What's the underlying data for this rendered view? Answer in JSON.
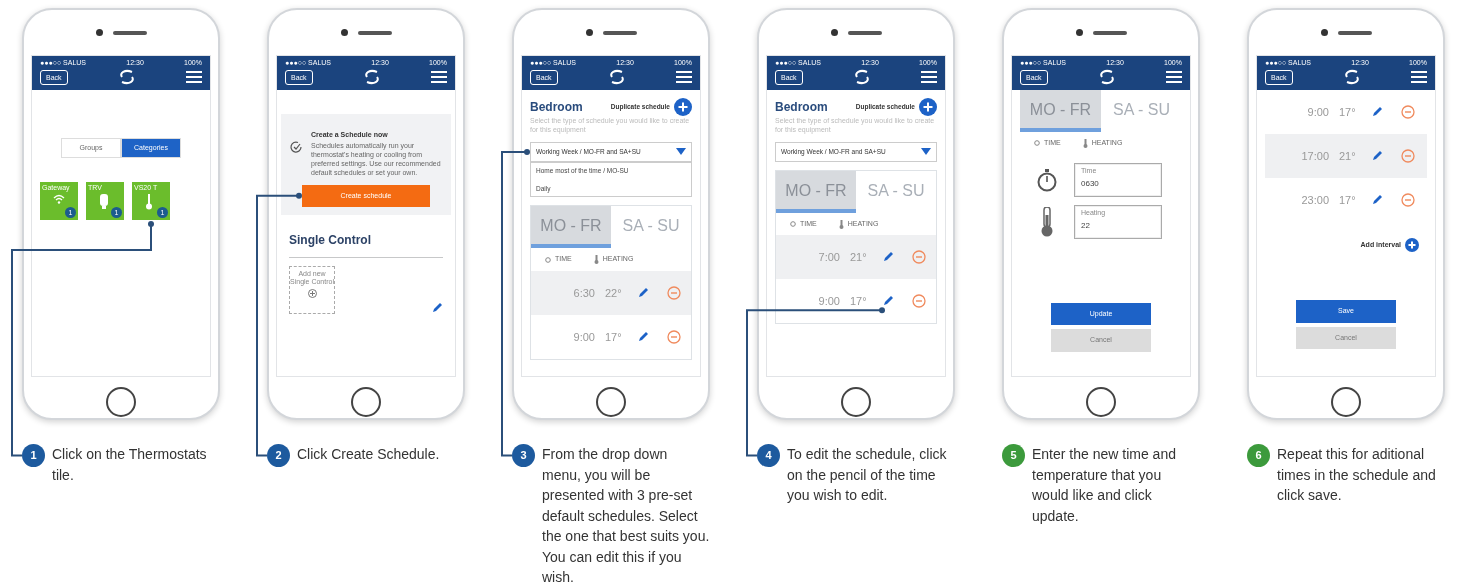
{
  "steps": [
    {
      "number": "1",
      "color": "#1d5a9e",
      "caption": "Click on the Thermostats tile.",
      "screen": {
        "kind": "devices",
        "status": {
          "carrier": "●●●○○ SALUS",
          "time": "12:30",
          "battery": "100%"
        },
        "back": "Back",
        "segments": [
          {
            "label": "Groups",
            "selected": false
          },
          {
            "label": "Categories",
            "selected": true
          }
        ],
        "tiles": [
          {
            "label": "Gateway",
            "count": "1",
            "kind": "gateway"
          },
          {
            "label": "TRV",
            "count": "1",
            "kind": "valve"
          },
          {
            "label": "VS20 T",
            "count": "1",
            "kind": "thermostat"
          }
        ]
      }
    },
    {
      "number": "2",
      "color": "#1d5a9e",
      "caption": "Click Create Schedule.",
      "screen": {
        "kind": "create",
        "status": {
          "carrier": "●●●○○ SALUS",
          "time": "12:30",
          "battery": "100%"
        },
        "back": "Back",
        "title": "Create a Schedule now",
        "text": "Schedules automatically run your thermostat's heating or cooling from preferred settings. Use our recommended default schedules or set your own.",
        "button": "Create schedule",
        "section": "Single Control",
        "add_label": "Add new Single Control"
      }
    },
    {
      "number": "3",
      "color": "#1d5a9e",
      "caption": "From the drop down menu, you will be presented with 3 pre-set default schedules. Select the one that best suits you. You can edit this if you wish.",
      "screen": {
        "kind": "schedule",
        "status": {
          "carrier": "●●●○○ SALUS",
          "time": "12:30",
          "battery": "100%"
        },
        "back": "Back",
        "room": "Bedroom",
        "duplicate": "Duplicate schedule",
        "hint": "Select the type of schedule you would like to create for this equipment",
        "dropdown": "Working Week / MO-FR and SA+SU",
        "options": [
          "Home most of the time / MO-SU",
          "Daily"
        ],
        "days": [
          {
            "label": "MO - FR",
            "selected": true
          },
          {
            "label": "SA - SU",
            "selected": false
          }
        ],
        "col_time": "TIME",
        "col_heating": "HEATING",
        "rows": [
          {
            "time": "6:30",
            "temp": "22°",
            "shaded": true
          },
          {
            "time": "9:00",
            "temp": "17°",
            "shaded": false
          }
        ]
      }
    },
    {
      "number": "4",
      "color": "#1d5a9e",
      "caption": "To edit the schedule, click on the pencil of the time you wish to edit.",
      "screen": {
        "kind": "schedule",
        "status": {
          "carrier": "●●●○○ SALUS",
          "time": "12:30",
          "battery": "100%"
        },
        "back": "Back",
        "room": "Bedroom",
        "duplicate": "Duplicate schedule",
        "hint": "Select the type of schedule you would like to create for this equipment",
        "dropdown": "Working Week / MO-FR and SA+SU",
        "days": [
          {
            "label": "MO - FR",
            "selected": true
          },
          {
            "label": "SA - SU",
            "selected": false
          }
        ],
        "col_time": "TIME",
        "col_heating": "HEATING",
        "rows": [
          {
            "time": "7:00",
            "temp": "21°",
            "shaded": true
          },
          {
            "time": "9:00",
            "temp": "17°",
            "shaded": false
          }
        ]
      }
    },
    {
      "number": "5",
      "color": "#3c9a3c",
      "caption": "Enter the new time and temperature that you would like and click update.",
      "screen": {
        "kind": "edit",
        "status": {
          "carrier": "●●●○○ SALUS",
          "time": "12:30",
          "battery": "100%"
        },
        "back": "Back",
        "days": [
          {
            "label": "MO - FR",
            "selected": true
          },
          {
            "label": "SA - SU",
            "selected": false
          }
        ],
        "col_time": "TIME",
        "col_heating": "HEATING",
        "fields": [
          {
            "label": "Time",
            "value": "0630",
            "kind": "time"
          },
          {
            "label": "Heating",
            "value": "22",
            "kind": "heating"
          }
        ],
        "primary": "Update",
        "cancel": "Cancel"
      }
    },
    {
      "number": "6",
      "color": "#3c9a3c",
      "caption": "Repeat this for aditional times in the schedule and click save.",
      "screen": {
        "kind": "list",
        "status": {
          "carrier": "●●●○○ SALUS",
          "time": "12:30",
          "battery": "100%"
        },
        "back": "Back",
        "rows": [
          {
            "time": "9:00",
            "temp": "17°",
            "shaded": false
          },
          {
            "time": "17:00",
            "temp": "21°",
            "shaded": true
          },
          {
            "time": "23:00",
            "temp": "17°",
            "shaded": false
          }
        ],
        "add": "Add interval",
        "primary": "Save",
        "cancel": "Cancel"
      }
    }
  ]
}
